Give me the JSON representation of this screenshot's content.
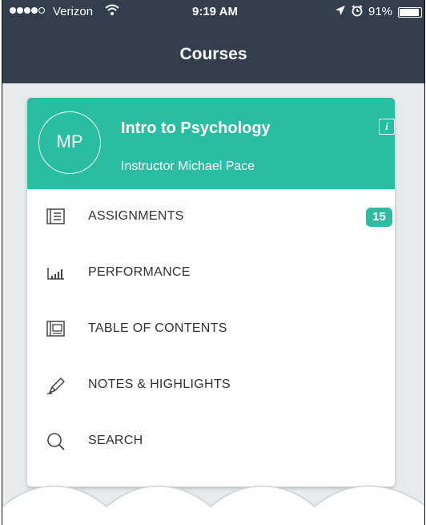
{
  "status_bar": {
    "carrier": "Verizon",
    "time": "9:19 AM",
    "battery_percent": "91%",
    "battery_level": 0.91,
    "signal_bars": 4,
    "signal_total": 5,
    "icons": [
      "wifi-icon",
      "location-arrow-icon",
      "alarm-icon",
      "battery-icon"
    ]
  },
  "nav": {
    "title": "Courses"
  },
  "course": {
    "initials": "MP",
    "title": "Intro to Psychology",
    "instructor": "Instructor Michael Pace",
    "info_icon": "info-icon"
  },
  "menu": {
    "items": [
      {
        "label": "ASSIGNMENTS",
        "icon": "assignments-icon",
        "badge": "15"
      },
      {
        "label": "PERFORMANCE",
        "icon": "bar-chart-icon"
      },
      {
        "label": "TABLE OF CONTENTS",
        "icon": "book-icon"
      },
      {
        "label": "NOTES & HIGHLIGHTS",
        "icon": "highlighter-icon"
      },
      {
        "label": "SEARCH",
        "icon": "search-icon"
      }
    ]
  },
  "colors": {
    "nav_bar": "#323e4e",
    "accent": "#29bda2",
    "background": "#e9eaec",
    "text": "#333333"
  }
}
